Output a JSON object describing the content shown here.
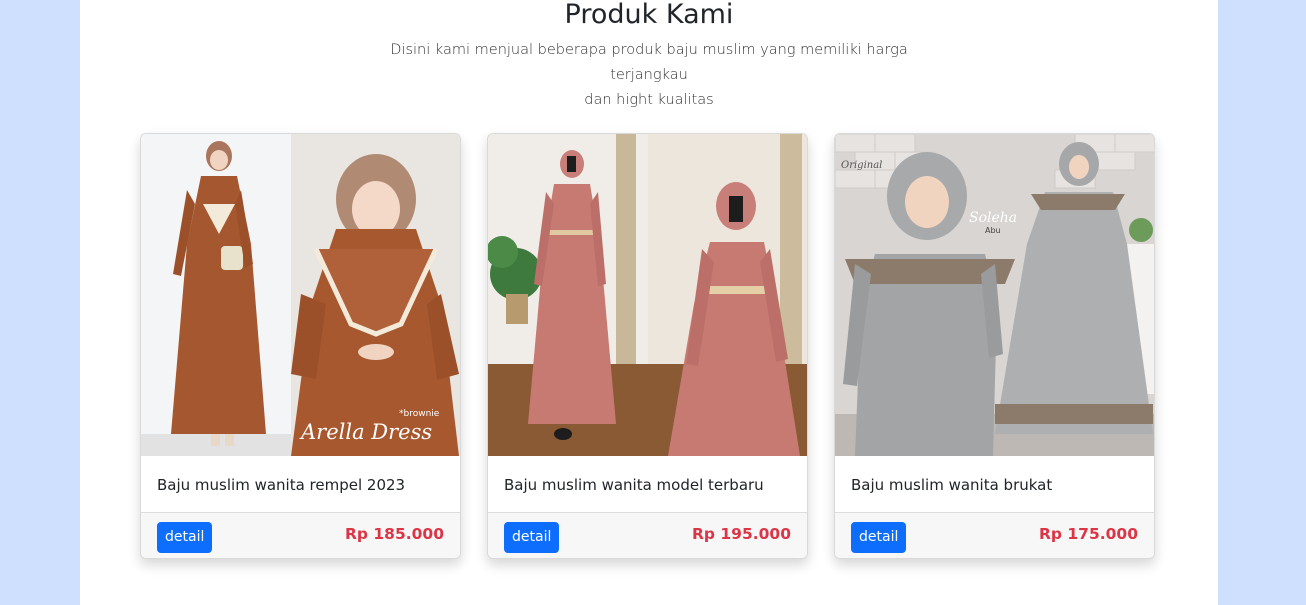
{
  "section": {
    "title": "Produk Kami",
    "subtitle_line1": "Disini kami menjual beberapa produk baju muslim yang memiliki harga terjangkau",
    "subtitle_line2": "dan hight kualitas"
  },
  "products": [
    {
      "name": "Baju muslim wanita rempel 2023",
      "price": "Rp 185.000",
      "detail_label": "detail",
      "image_caption": "Arella Dress",
      "image_tag": "*brownie"
    },
    {
      "name": "Baju muslim wanita model terbaru",
      "price": "Rp 195.000",
      "detail_label": "detail"
    },
    {
      "name": "Baju muslim wanita brukat",
      "price": "Rp 175.000",
      "detail_label": "detail",
      "image_tag": "Original",
      "image_caption": "Soleha",
      "image_color": "Abu"
    }
  ],
  "colors": {
    "page_bg": "#cfe0ff",
    "button": "#0d6efd",
    "price": "#dc3545",
    "dress_brown": "#a65a33",
    "dress_pink": "#c77a72",
    "dress_grey": "#a9aaac"
  }
}
